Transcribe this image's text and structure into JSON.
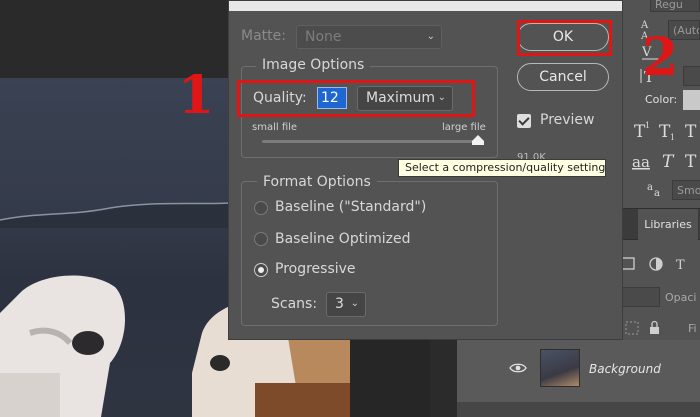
{
  "dialog": {
    "matte": {
      "label": "Matte:",
      "value": "None"
    },
    "image_options": {
      "legend": "Image Options",
      "quality_label": "Quality:",
      "quality_value": "12",
      "quality_preset": "Maximum",
      "small_file": "small file",
      "large_file": "large file",
      "quality_slider_fraction": 1.0,
      "tooltip": "Select a compression/quality setting",
      "partial_size_text": "91.0K"
    },
    "format_options": {
      "legend": "Format Options",
      "options": [
        {
          "label": "Baseline (\"Standard\")",
          "selected": false
        },
        {
          "label": "Baseline Optimized",
          "selected": false
        },
        {
          "label": "Progressive",
          "selected": true
        }
      ],
      "scans_label": "Scans:",
      "scans_value": "3"
    },
    "buttons": {
      "ok": "OK",
      "cancel": "Cancel"
    },
    "preview": {
      "label": "Preview",
      "checked": true
    }
  },
  "annotations": {
    "step1": "1",
    "step2": "2",
    "color": "#e01616"
  },
  "right_panel": {
    "top_text": "Regu",
    "auto_text": "(Auto",
    "color_label": "Color:",
    "aa_text": "Smo",
    "libraries_tab": "Libraries",
    "opacity_text": "Opaci",
    "fill_text": "Fi"
  },
  "layers": {
    "background_name": "Background"
  },
  "colors": {
    "panel": "#535353",
    "accent_blue": "#1f67d0",
    "tooltip_bg": "#ffffe1"
  },
  "icons": [
    "eye-icon",
    "chevron-down-icon",
    "checkmark-icon",
    "radio-selected-icon",
    "slider-thumb-icon",
    "text-style-icon",
    "lock-icon",
    "mask-icon"
  ]
}
